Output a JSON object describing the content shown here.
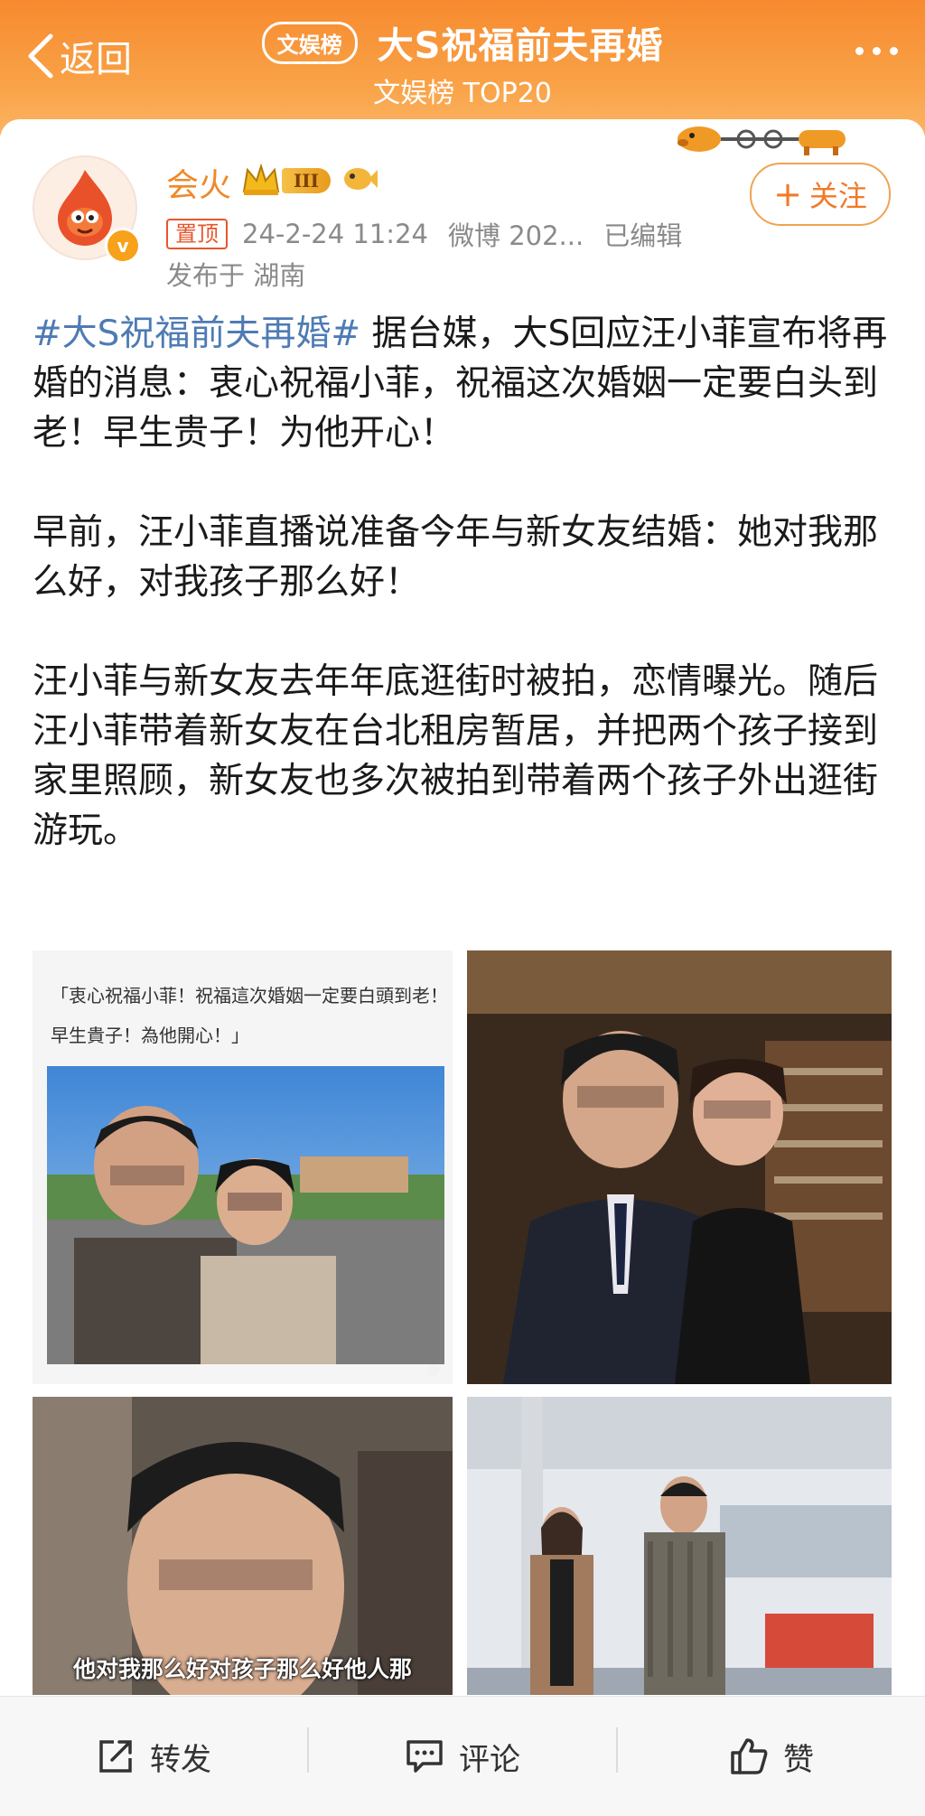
{
  "header": {
    "back_label": "返回",
    "tag": "文娱榜",
    "title": "大S祝福前夫再婚",
    "subtitle": "文娱榜 TOP20",
    "more_icon": "more-dots-icon"
  },
  "post": {
    "username": "会火",
    "level_badge": "III",
    "verified_mark": "v",
    "pinned_label": "置顶",
    "date": "24-2-24 11:24",
    "source": "微博 202...",
    "edited": "已编辑",
    "location": "发布于 湖南",
    "follow_label": "关注",
    "hashtag": "#大S祝福前夫再婚#",
    "para1_rest": " 据台媒，大S回应汪小菲宣布将再婚的消息：衷心祝福小菲，祝福这次婚姻一定要白头到老！早生贵子！为他开心！",
    "para2": "早前，汪小菲直播说准备今年与新女友结婚：她对我那么好，对我孩子那么好！",
    "para3": "汪小菲与新女友去年年底逛街时被拍，恋情曝光。随后汪小菲带着新女友在台北租房暂居，并把两个孩子接到家里照顾，新女友也多次被拍到带着两个孩子外出逛街游玩。"
  },
  "images": {
    "img1_caption": "「衷心祝福小菲！祝福這次婚姻一定要白頭到老！早生貴子！為他開心！」",
    "img3_caption": "他对我那么好对孩子那么好他人那"
  },
  "actions": {
    "repost": "转发",
    "comment": "评论",
    "like": "赞"
  },
  "colors": {
    "header_orange": "#f78a2f",
    "username": "#f0882a",
    "hashtag": "#4e7bb4"
  }
}
